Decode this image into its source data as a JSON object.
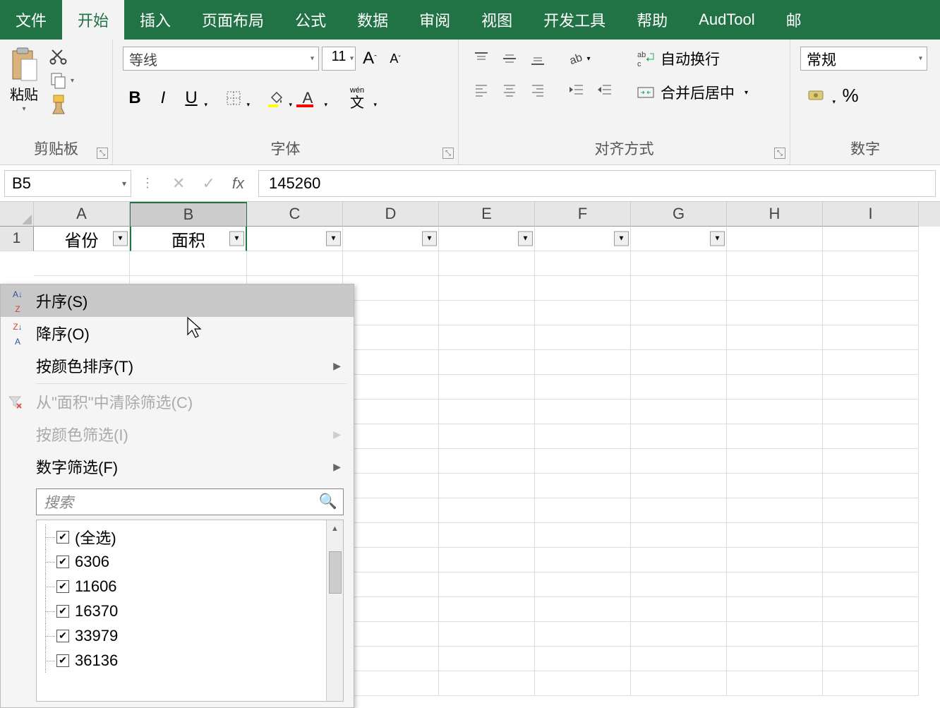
{
  "ribbon": {
    "tabs": [
      "文件",
      "开始",
      "插入",
      "页面布局",
      "公式",
      "数据",
      "审阅",
      "视图",
      "开发工具",
      "帮助",
      "AudTool",
      "邮"
    ],
    "active_tab": "开始"
  },
  "groups": {
    "clipboard": {
      "label": "剪贴板",
      "paste": "粘贴"
    },
    "font": {
      "label": "字体",
      "name": "等线",
      "size": "11",
      "bold": "B",
      "italic": "I",
      "underline": "U"
    },
    "alignment": {
      "label": "对齐方式",
      "wrap": "自动换行",
      "merge": "合并后居中"
    },
    "number": {
      "label": "数字",
      "format": "常规",
      "pct": "%"
    }
  },
  "formula_bar": {
    "cell_ref": "B5",
    "value": "145260",
    "fx": "fx"
  },
  "grid": {
    "columns": [
      "A",
      "B",
      "C",
      "D",
      "E",
      "F",
      "G",
      "H",
      "I"
    ],
    "row1": {
      "A": "省份",
      "B": "面积"
    },
    "visible_row_nums": [
      "1"
    ]
  },
  "filter_menu": {
    "sort_asc": "升序(S)",
    "sort_desc": "降序(O)",
    "sort_by_color": "按颜色排序(T)",
    "clear_filter": "从\"面积\"中清除筛选(C)",
    "filter_by_color": "按颜色筛选(I)",
    "number_filter": "数字筛选(F)",
    "search_placeholder": "搜索",
    "select_all": "(全选)",
    "items": [
      "6306",
      "11606",
      "16370",
      "33979",
      "36136"
    ]
  }
}
